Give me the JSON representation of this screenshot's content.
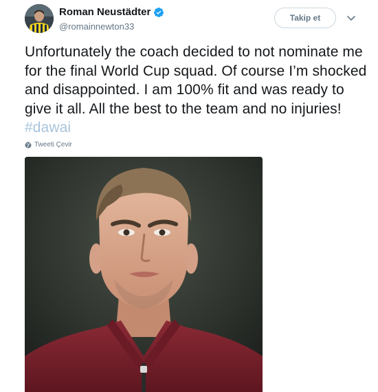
{
  "tweet": {
    "author_name": "Roman Neustädter",
    "author_handle": "@romainnewton33",
    "follow_label": "Takip et",
    "text_main": "Unfortunately the coach decided to not nominate me for the final World Cup squad. Of course I’m shocked and disappointed. I am 100% fit and was ready to give it all. All the best to the team and no injuries! ",
    "hashtag": "#dawai",
    "translate_label": "Tweeti Çevir"
  },
  "colors": {
    "verified_badge": "#1da1f2",
    "hashtag": "#a8c4dc",
    "secondary_text": "#657786",
    "jersey": "#7a1f2b"
  },
  "icons": {
    "verified": "verified-badge-icon",
    "chevron": "chevron-down-icon",
    "globe": "globe-icon"
  }
}
